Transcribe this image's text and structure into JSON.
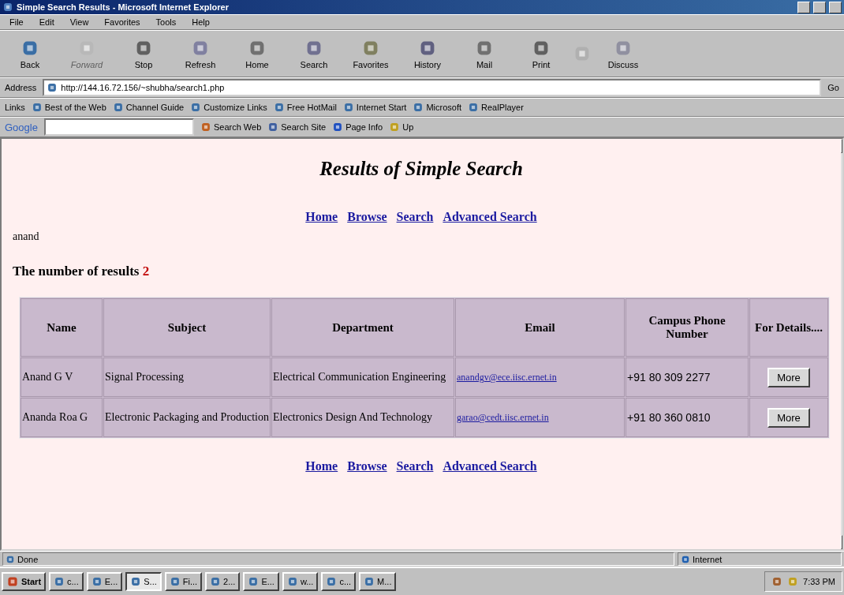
{
  "window": {
    "title": "Simple Search Results - Microsoft Internet Explorer"
  },
  "menu": [
    "File",
    "Edit",
    "View",
    "Favorites",
    "Tools",
    "Help"
  ],
  "toolbar": [
    {
      "label": "Back",
      "disabled": false
    },
    {
      "label": "Forward",
      "disabled": true
    },
    {
      "label": "Stop",
      "disabled": false
    },
    {
      "label": "Refresh",
      "disabled": false
    },
    {
      "label": "Home",
      "disabled": false
    },
    {
      "label": "Search",
      "disabled": false
    },
    {
      "label": "Favorites",
      "disabled": false
    },
    {
      "label": "History",
      "disabled": false
    },
    {
      "label": "Mail",
      "disabled": false
    },
    {
      "label": "Print",
      "disabled": false
    },
    {
      "label": "Discuss",
      "disabled": false
    }
  ],
  "address": {
    "label": "Address",
    "url": "http://144.16.72.156/~shubha/search1.php",
    "go": "Go"
  },
  "links": {
    "label": "Links",
    "items": [
      "Best of the Web",
      "Channel Guide",
      "Customize Links",
      "Free HotMail",
      "Internet Start",
      "Microsoft",
      "RealPlayer"
    ]
  },
  "google": {
    "logo": "Google",
    "buttons": [
      "Search Web",
      "Search Site",
      "Page Info",
      "Up"
    ]
  },
  "page": {
    "heading": "Results of Simple Search",
    "nav_top": [
      "Home",
      "Browse",
      "Search",
      "Advanced Search"
    ],
    "query": "anand",
    "count_label": "The number of results",
    "count": "2",
    "columns": [
      "Name",
      "Subject",
      "Department",
      "Email",
      "Campus Phone Number",
      "For Details...."
    ],
    "rows": [
      {
        "name": "Anand G V",
        "subject": "Signal Processing",
        "department": "Electrical Communication Engineering",
        "email": "anandgv@ece.iisc.ernet.in",
        "phone": "+91 80 309 2277",
        "button": "More"
      },
      {
        "name": "Ananda Roa G",
        "subject": "Electronic Packaging and Production",
        "department": "Electronics Design And Technology",
        "email": "garao@cedt.iisc.ernet.in",
        "phone": "+91 80 360 0810",
        "button": "More"
      }
    ],
    "nav_bottom": [
      "Home",
      "Browse",
      "Search",
      "Advanced Search"
    ]
  },
  "status_bar": {
    "text": "Done",
    "zone": "Internet"
  },
  "taskbar": {
    "start": "Start",
    "tasks": [
      {
        "label": "c...",
        "selected": false
      },
      {
        "label": "E...",
        "selected": false
      },
      {
        "label": "S...",
        "selected": true
      },
      {
        "label": "Fi...",
        "selected": false
      },
      {
        "label": "2...",
        "selected": false
      },
      {
        "label": "E...",
        "selected": false
      },
      {
        "label": "w...",
        "selected": false
      },
      {
        "label": "c...",
        "selected": false
      },
      {
        "label": "M...",
        "selected": false
      }
    ],
    "time": "7:33 PM"
  }
}
